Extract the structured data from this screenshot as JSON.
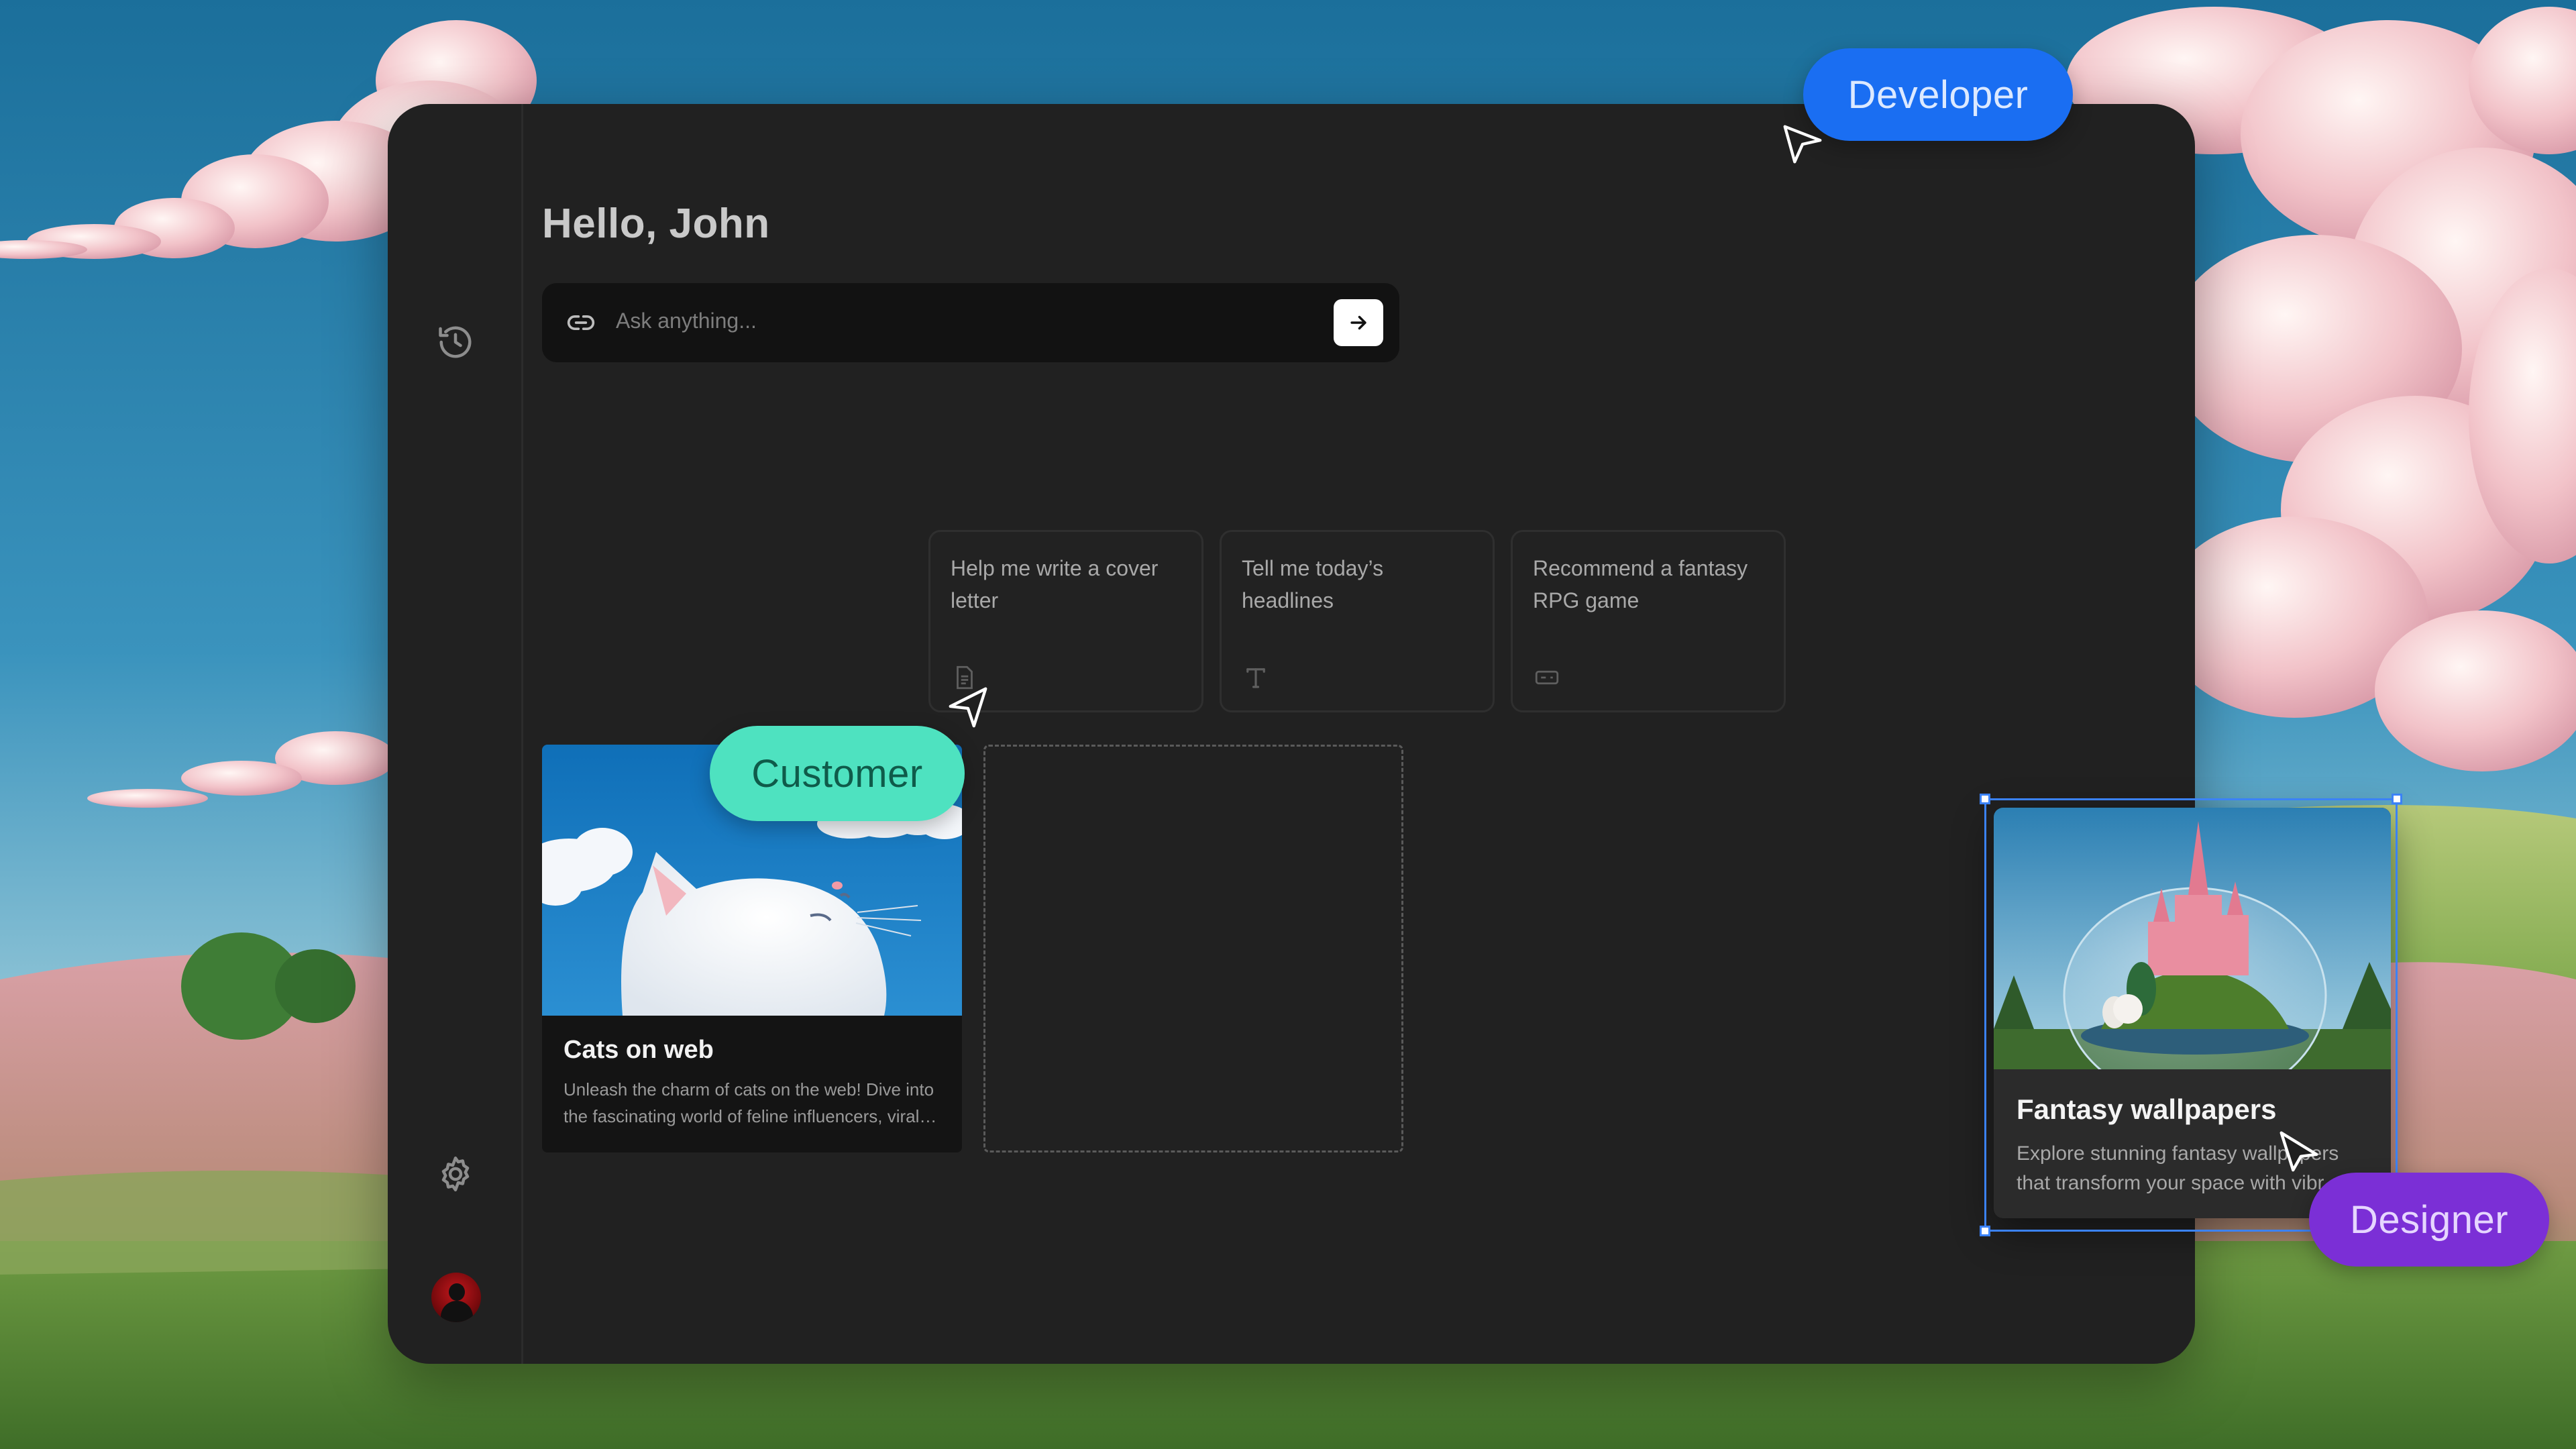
{
  "app": {
    "greeting": "Hello, John",
    "search": {
      "placeholder": "Ask anything..."
    },
    "sidebar": {
      "top_icon": "history-icon",
      "bottom_icons": [
        "gear-icon",
        "avatar"
      ]
    },
    "suggestions": [
      {
        "label": "Help me write a cover letter",
        "icon": "document-icon"
      },
      {
        "label": "Tell me today’s headlines",
        "icon": "text-icon"
      },
      {
        "label": "Recommend a fantasy RPG game",
        "icon": "gamepad-icon"
      }
    ],
    "cards": [
      {
        "title": "Cats on web",
        "description": "Unleash the charm of cats on the web! Dive into the fascinating world of feline influencers, viral…"
      }
    ]
  },
  "floating_card": {
    "title": "Fantasy wallpapers",
    "description_line1": "Explore stunning fantasy wallpapers",
    "description_line2": "that transform your space with vibr"
  },
  "collaborators": {
    "developer": "Developer",
    "customer": "Customer",
    "designer": "Designer"
  },
  "colors": {
    "developer": "#1a6ef2",
    "customer": "#4ee2c0",
    "designer": "#7b2fd6",
    "selection": "#3b82f6",
    "window": "#212121"
  }
}
